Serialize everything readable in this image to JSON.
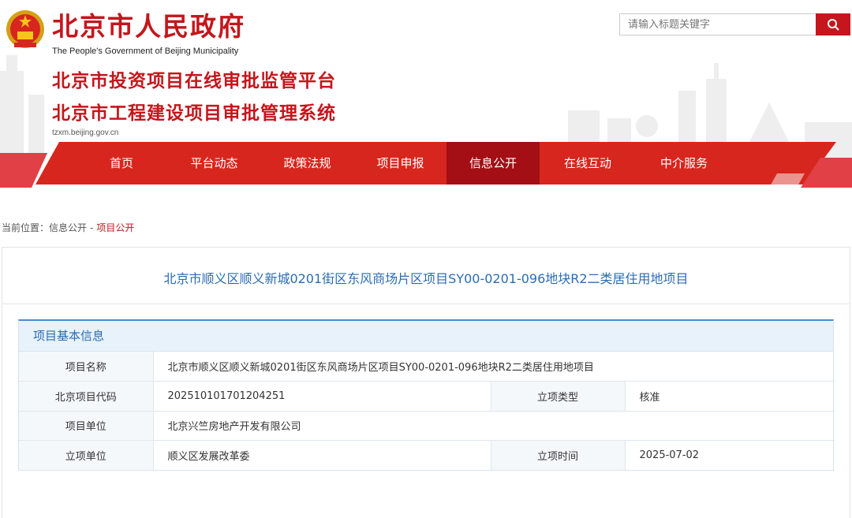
{
  "header": {
    "gov_title": "北京市人民政府",
    "gov_subtitle": "The People's Government of Beijing Municipality",
    "platform_title_1": "北京市投资项目在线审批监管平台",
    "platform_title_2": "北京市工程建设项目审批管理系统",
    "site_url": "tzxm.beijing.gov.cn",
    "search_placeholder": "请输入标题关键字",
    "brand_color": "#c4161c"
  },
  "nav": {
    "items": [
      {
        "label": "首页"
      },
      {
        "label": "平台动态"
      },
      {
        "label": "政策法规"
      },
      {
        "label": "项目申报"
      },
      {
        "label": "信息公开"
      },
      {
        "label": "在线互动"
      },
      {
        "label": "中介服务"
      }
    ],
    "active": "信息公开"
  },
  "breadcrumb": {
    "prefix": "当前位置：",
    "level1": "信息公开",
    "sep": "-",
    "level2": "项目公开"
  },
  "project": {
    "title": "北京市顺义区顺义新城0201街区东风商场片区项目SY00-0201-096地块R2二类居住用地项目",
    "section_title": "项目基本信息",
    "rows": {
      "name_label": "项目名称",
      "name_value": "北京市顺义区顺义新城0201街区东风商场片区项目SY00-0201-096地块R2二类居住用地项目",
      "code_label": "北京项目代码",
      "code_value": "2025101017012 04251",
      "type_label": "立项类型",
      "type_value": "核准",
      "unit_label": "项目单位",
      "unit_value": "北京兴竺房地产开发有限公司",
      "approve_unit_label": "立项单位",
      "approve_unit_value": "顺义区发展改革委",
      "approve_time_label": "立项时间",
      "approve_time_value": "2025-07-02"
    }
  }
}
